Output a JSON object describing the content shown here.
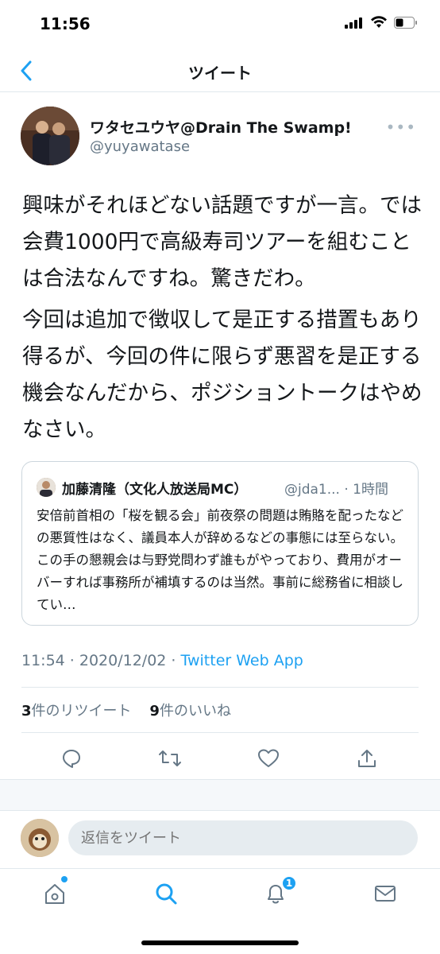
{
  "status_bar": {
    "time": "11:56"
  },
  "nav": {
    "title": "ツイート"
  },
  "tweet": {
    "author_name": "ワタセユウヤ@Drain The Swamp!",
    "author_handle": "@yuyawatase",
    "paragraph1": "興味がそれほどない話題ですが一言。では会費1000円で高級寿司ツアーを組むことは合法なんですね。驚きだわ。",
    "paragraph2": "今回は追加で徴収して是正する措置もあり得るが、今回の件に限らず悪習を是正する機会なんだから、ポジショントークはやめなさい。",
    "timestamp": "11:54 · 2020/12/02 · ",
    "source": "Twitter Web App",
    "retweet_count": "3",
    "retweet_label": "件のリツイート",
    "like_count": "9",
    "like_label": "件のいいね"
  },
  "quote": {
    "name": "加藤清隆（文化人放送局MC）",
    "handle": "@jda1... · 1時間",
    "text": "安倍前首相の「桜を観る会」前夜祭の問題は賄賂を配ったなどの悪質性はなく、議員本人が辞めるなどの事態には至らない。この手の懇親会は与野党問わず誰もがやっており、費用がオーバーすれば事務所が補填するのは当然。事前に総務省に相談してい…"
  },
  "reply": {
    "placeholder": "返信をツイート"
  },
  "tabs": {
    "notification_badge": "1"
  },
  "colors": {
    "accent": "#1da1f2",
    "secondary_text": "#657786",
    "border": "#e1e8ed"
  }
}
